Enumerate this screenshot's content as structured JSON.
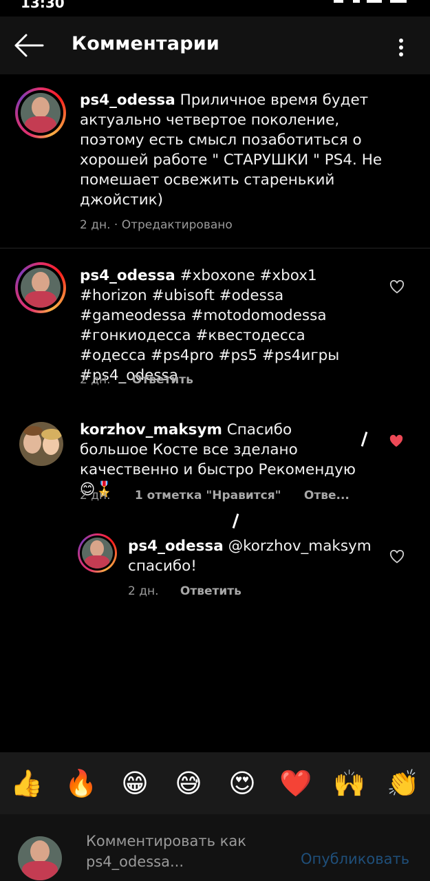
{
  "status_bar": {
    "time": "13:30"
  },
  "header": {
    "title": "Комментарии",
    "back_icon": "arrow-left-icon",
    "menu_icon": "more-vertical-icon"
  },
  "comments": [
    {
      "user": "ps4_odessa",
      "text": "Приличное время будет актуально четвертое поколение, поэтому есть смысл позаботиться о хорошей работе \" СТАРУШКИ \" PS4. Не помешает освежить старенький джойстик)",
      "time": "2 дн.",
      "edited": "· Отредактировано"
    },
    {
      "user": "ps4_odessa",
      "text": "#xboxone #xbox1 #horizon #ubisoft #odessa #gameodessa #motodomodessa #гонкиодесса #квестодесса #одесса #ps4pro #ps5 #ps4игры #ps4_odessa",
      "time": "2 дн.",
      "reply": "Ответить",
      "liked": false
    },
    {
      "user": "korzhov_maksym",
      "text": "Спасибо большое Косте все зделано качественно и быстро  Рекомендую😊🎖️",
      "time": "2 дн.",
      "likes": "1 отметка \"Нравится\"",
      "reply": "Отве...",
      "liked": true
    },
    {
      "user": "ps4_odessa",
      "text": "@korzhov_maksym спасибо!",
      "time": "2 дн.",
      "reply": "Ответить",
      "liked": false
    }
  ],
  "emoji_bar": [
    "👍",
    "🔥",
    "😁",
    "😅",
    "😍",
    "❤️",
    "🙌",
    "👏"
  ],
  "composer": {
    "placeholder": "Комментировать как ps4_odessa...",
    "publish_label": "Опубликовать"
  },
  "colors": {
    "accent_heart": "#ed4956",
    "publish_disabled": "#1f4f7a"
  }
}
